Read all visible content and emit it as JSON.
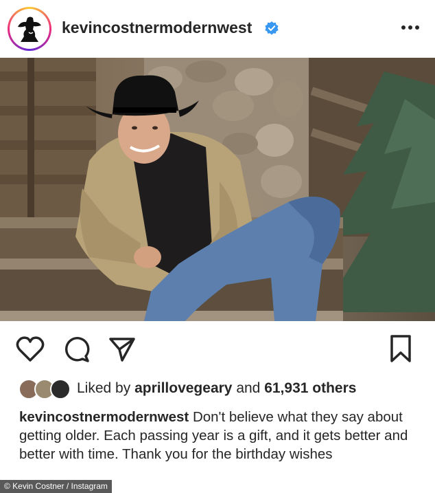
{
  "header": {
    "username": "kevincostnermodernwest",
    "verified_icon": "verified-badge-icon",
    "more_icon": "more-options-icon",
    "accent_color": "#3897f0"
  },
  "post": {
    "image_description_icon": "post-photo",
    "actions": {
      "like_icon": "heart-icon",
      "comment_icon": "comment-icon",
      "share_icon": "send-icon",
      "save_icon": "bookmark-icon"
    },
    "likes": {
      "prefix": "Liked by",
      "first_user": "aprillovegeary",
      "connector": "and",
      "others": "61,931 others"
    },
    "caption": {
      "username": "kevincostnermodernwest",
      "text": "Don't believe what they say about getting older. Each passing year is a gift, and it gets better and better with time. Thank you for the birthday wishes"
    }
  },
  "credit": "© Kevin Costner / Instagram"
}
